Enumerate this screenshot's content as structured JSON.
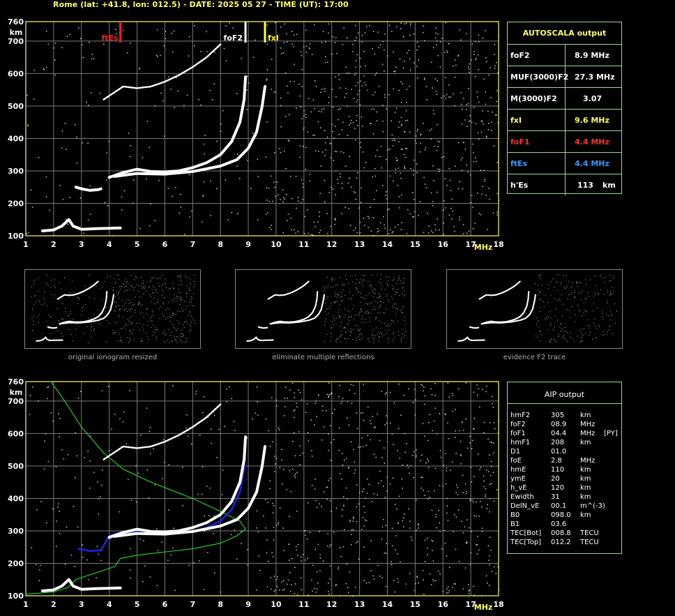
{
  "header": {
    "title": "Rome (lat: +41.8, lon: 012.5) - DATE: 2025 05 27 - TIME (UT): 17:00"
  },
  "colors": {
    "grid": "#7a7a7a",
    "frame": "#ffff66",
    "panel_border": "#9fd99f",
    "trace": "#ffffff",
    "fof2_marker": "#ffffff",
    "fxl_marker": "#ffff33",
    "ftes_marker": "#ff2020",
    "profile": "#22cc22",
    "fit": "#2222ff",
    "label_yellow": "#ffff66",
    "label_red": "#ff3030",
    "label_blue": "#3399ff"
  },
  "autoscala": {
    "title": "AUTOSCALA output",
    "rows": [
      {
        "label": "foF2",
        "value": "8.9 MHz",
        "color": "#ffffff"
      },
      {
        "label": "MUF(3000)F2",
        "value": "27.3 MHz",
        "color": "#ffffff"
      },
      {
        "label": "M(3000)F2",
        "value": "3.07",
        "color": "#ffffff"
      },
      {
        "label": "fxI",
        "value": "9.6 MHz",
        "color": "#ffff66"
      },
      {
        "label": "foF1",
        "value": "4.4 MHz",
        "color": "#ff3030"
      },
      {
        "label": "ftEs",
        "value": "4.4 MHz",
        "color": "#3399ff"
      },
      {
        "label": "h'Es",
        "value": "113",
        "unit": "km",
        "color": "#ffffff"
      }
    ]
  },
  "markers": {
    "ftes_label": "ftEs",
    "fof2_label": "foF2",
    "fxl_label": "fxI"
  },
  "thumbnails": [
    {
      "caption": "original ionogram resized"
    },
    {
      "caption": "eliminate multiple reflections"
    },
    {
      "caption": "evidence F2 trace"
    }
  ],
  "aip": {
    "title": "AIP output",
    "rows": [
      {
        "name": "hmF2",
        "value": "305",
        "unit": "km",
        "flag": ""
      },
      {
        "name": "foF2",
        "value": "08.9",
        "unit": "MHz",
        "flag": ""
      },
      {
        "name": "foF1",
        "value": "04.4",
        "unit": "MHz",
        "flag": "[PY]"
      },
      {
        "name": "hmF1",
        "value": "208",
        "unit": "km",
        "flag": ""
      },
      {
        "name": "D1",
        "value": "01.0",
        "unit": "",
        "flag": ""
      },
      {
        "name": "foE",
        "value": "2.8",
        "unit": "MHz",
        "flag": ""
      },
      {
        "name": "hmE",
        "value": "110",
        "unit": "km",
        "flag": ""
      },
      {
        "name": "ymE",
        "value": "20",
        "unit": "km",
        "flag": ""
      },
      {
        "name": "h_vE",
        "value": "120",
        "unit": "km",
        "flag": ""
      },
      {
        "name": "Ewidth",
        "value": "31",
        "unit": "km",
        "flag": ""
      },
      {
        "name": "DelN_vE",
        "value": "00.1",
        "unit": "m^(-3)",
        "flag": ""
      },
      {
        "name": "B0",
        "value": "098.0",
        "unit": "km",
        "flag": ""
      },
      {
        "name": "B1",
        "value": "03.6",
        "unit": "",
        "flag": ""
      },
      {
        "name": "TEC[Bot]",
        "value": "008.8",
        "unit": "TECU",
        "flag": ""
      },
      {
        "name": "TEC[Top]",
        "value": "012.2",
        "unit": "TECU",
        "flag": ""
      }
    ]
  },
  "chart_data": [
    {
      "type": "scatter",
      "title": "",
      "xlabel": "MHz",
      "ylabel": "km",
      "xlim": [
        1,
        18
      ],
      "ylim": [
        100,
        760
      ],
      "x_ticks": [
        1,
        2,
        3,
        4,
        5,
        6,
        7,
        8,
        9,
        10,
        11,
        12,
        13,
        14,
        15,
        16,
        17,
        18
      ],
      "y_ticks": [
        100,
        200,
        300,
        400,
        500,
        600,
        700,
        760
      ],
      "grid": true,
      "markers_mhz": {
        "ftEs": 4.4,
        "foF2": 8.9,
        "fxI": 9.6
      },
      "series": [
        {
          "name": "E-Es trace",
          "points": [
            [
              1.6,
              115
            ],
            [
              2.0,
              118
            ],
            [
              2.3,
              130
            ],
            [
              2.55,
              150
            ],
            [
              2.7,
              130
            ],
            [
              3.0,
              120
            ],
            [
              3.5,
              122
            ],
            [
              4.0,
              123
            ],
            [
              4.4,
              124
            ]
          ]
        },
        {
          "name": "F1 low trace",
          "points": [
            [
              2.8,
              250
            ],
            [
              3.0,
              245
            ],
            [
              3.3,
              240
            ],
            [
              3.6,
              242
            ],
            [
              3.7,
              245
            ]
          ]
        },
        {
          "name": "F ordinary trace",
          "points": [
            [
              4.0,
              280
            ],
            [
              4.5,
              295
            ],
            [
              5.0,
              305
            ],
            [
              5.5,
              298
            ],
            [
              6.0,
              297
            ],
            [
              6.5,
              300
            ],
            [
              7.0,
              310
            ],
            [
              7.5,
              325
            ],
            [
              8.0,
              350
            ],
            [
              8.4,
              390
            ],
            [
              8.7,
              450
            ],
            [
              8.85,
              520
            ],
            [
              8.9,
              590
            ]
          ]
        },
        {
          "name": "F extraordinary trace",
          "points": [
            [
              4.2,
              283
            ],
            [
              5.0,
              292
            ],
            [
              6.0,
              290
            ],
            [
              7.0,
              298
            ],
            [
              8.0,
              315
            ],
            [
              8.6,
              335
            ],
            [
              9.0,
              370
            ],
            [
              9.3,
              420
            ],
            [
              9.5,
              500
            ],
            [
              9.6,
              560
            ]
          ]
        },
        {
          "name": "second-hop trace",
          "points": [
            [
              3.8,
              520
            ],
            [
              4.5,
              560
            ],
            [
              5.0,
              555
            ],
            [
              5.5,
              560
            ],
            [
              6.0,
              575
            ],
            [
              6.5,
              595
            ],
            [
              7.0,
              620
            ],
            [
              7.5,
              650
            ],
            [
              8.0,
              690
            ]
          ]
        }
      ]
    },
    {
      "type": "line",
      "title": "",
      "xlabel": "MHz",
      "ylabel": "km",
      "xlim": [
        1,
        18
      ],
      "ylim": [
        100,
        760
      ],
      "x_ticks": [
        1,
        2,
        3,
        4,
        5,
        6,
        7,
        8,
        9,
        10,
        11,
        12,
        13,
        14,
        15,
        16,
        17,
        18
      ],
      "y_ticks": [
        100,
        200,
        300,
        400,
        500,
        600,
        700,
        760
      ],
      "grid": true,
      "series": [
        {
          "name": "true height profile",
          "points": [
            [
              1.0,
              105
            ],
            [
              1.5,
              108
            ],
            [
              2.0,
              112
            ],
            [
              2.5,
              125
            ],
            [
              2.8,
              150
            ],
            [
              3.5,
              170
            ],
            [
              4.2,
              190
            ],
            [
              4.4,
              215
            ],
            [
              5.0,
              225
            ],
            [
              6.0,
              235
            ],
            [
              7.0,
              245
            ],
            [
              8.0,
              262
            ],
            [
              8.6,
              285
            ],
            [
              8.9,
              305
            ],
            [
              8.7,
              330
            ],
            [
              8.0,
              360
            ],
            [
              7.0,
              400
            ],
            [
              5.5,
              450
            ],
            [
              4.5,
              490
            ],
            [
              3.8,
              540
            ],
            [
              3.0,
              620
            ],
            [
              2.4,
              700
            ],
            [
              1.9,
              760
            ]
          ]
        },
        {
          "name": "fitted trace",
          "points": [
            [
              2.9,
              245
            ],
            [
              3.3,
              238
            ],
            [
              3.7,
              240
            ],
            [
              4.0,
              285
            ],
            [
              4.5,
              297
            ],
            [
              5.0,
              295
            ],
            [
              6.0,
              290
            ],
            [
              7.0,
              296
            ],
            [
              7.5,
              310
            ],
            [
              8.0,
              330
            ],
            [
              8.4,
              365
            ],
            [
              8.7,
              420
            ],
            [
              8.85,
              490
            ],
            [
              8.9,
              560
            ]
          ]
        },
        {
          "name": "observed F trace",
          "points": [
            [
              4.0,
              280
            ],
            [
              4.5,
              295
            ],
            [
              5.0,
              305
            ],
            [
              5.5,
              298
            ],
            [
              6.0,
              297
            ],
            [
              6.5,
              300
            ],
            [
              7.0,
              310
            ],
            [
              7.5,
              325
            ],
            [
              8.0,
              350
            ],
            [
              8.4,
              390
            ],
            [
              8.7,
              450
            ],
            [
              8.85,
              520
            ],
            [
              8.9,
              590
            ]
          ]
        },
        {
          "name": "observed X trace",
          "points": [
            [
              4.2,
              283
            ],
            [
              5.0,
              292
            ],
            [
              6.0,
              290
            ],
            [
              7.0,
              298
            ],
            [
              8.0,
              315
            ],
            [
              8.6,
              335
            ],
            [
              9.0,
              370
            ],
            [
              9.3,
              420
            ],
            [
              9.5,
              500
            ],
            [
              9.6,
              560
            ]
          ]
        },
        {
          "name": "E-Es trace",
          "points": [
            [
              1.6,
              115
            ],
            [
              2.0,
              118
            ],
            [
              2.3,
              130
            ],
            [
              2.55,
              150
            ],
            [
              2.7,
              130
            ],
            [
              3.0,
              120
            ],
            [
              3.5,
              122
            ],
            [
              4.0,
              123
            ],
            [
              4.4,
              124
            ]
          ]
        },
        {
          "name": "second-hop trace",
          "points": [
            [
              3.8,
              520
            ],
            [
              4.5,
              560
            ],
            [
              5.0,
              555
            ],
            [
              5.5,
              560
            ],
            [
              6.0,
              575
            ],
            [
              6.5,
              595
            ],
            [
              7.0,
              620
            ],
            [
              7.5,
              650
            ],
            [
              8.0,
              690
            ]
          ]
        }
      ]
    }
  ]
}
